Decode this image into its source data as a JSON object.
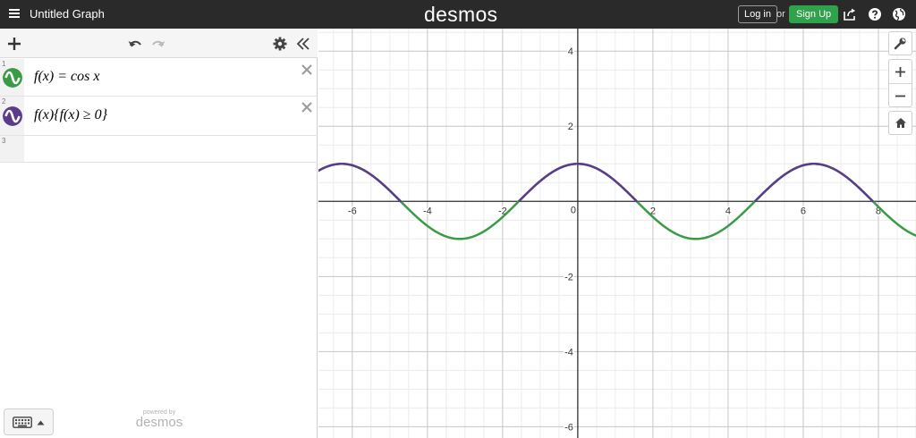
{
  "header": {
    "title": "Untitled Graph",
    "logo": "desmos",
    "login_label": "Log in",
    "or_label": "or",
    "signup_label": "Sign Up",
    "icons": [
      "menu-icon",
      "share-icon",
      "help-icon",
      "globe-icon"
    ]
  },
  "toolbar": {
    "icons": [
      "plus-icon",
      "undo-icon",
      "redo-icon",
      "gear-icon",
      "collapse-icon"
    ]
  },
  "expressions": [
    {
      "number": "1",
      "latex": "f(x) = cos x",
      "color": "#3a9b46"
    },
    {
      "number": "2",
      "latex": "f(x){f(x) ≥ 0}",
      "color": "#5b3c8c"
    },
    {
      "number": "3",
      "latex": "",
      "color": ""
    }
  ],
  "footer": {
    "powered_by": "powered by",
    "logo": "desmos"
  },
  "graph": {
    "side_icons": [
      "wrench-icon",
      "zoom-in-icon",
      "zoom-out-icon",
      "home-icon"
    ]
  },
  "chart_data": {
    "type": "line",
    "xlim": [
      -6.9,
      9.0
    ],
    "ylim": [
      -6.3,
      4.6
    ],
    "x_ticks": [
      "-6",
      "-4",
      "-2",
      "0",
      "2",
      "4",
      "6",
      "8"
    ],
    "y_ticks": [
      "4",
      "2",
      "-2",
      "-4",
      "-6"
    ],
    "grid": true,
    "series": [
      {
        "expression": "f(x) = cos x",
        "color": "#3a9b46",
        "function": "cos",
        "domain": [
          -6.9,
          9.0
        ]
      },
      {
        "expression": "f(x){f(x) ≥ 0}",
        "color": "#5b3c8c",
        "function": "cos",
        "restriction": "f(x) >= 0",
        "domain": [
          -6.9,
          9.0
        ]
      }
    ]
  }
}
